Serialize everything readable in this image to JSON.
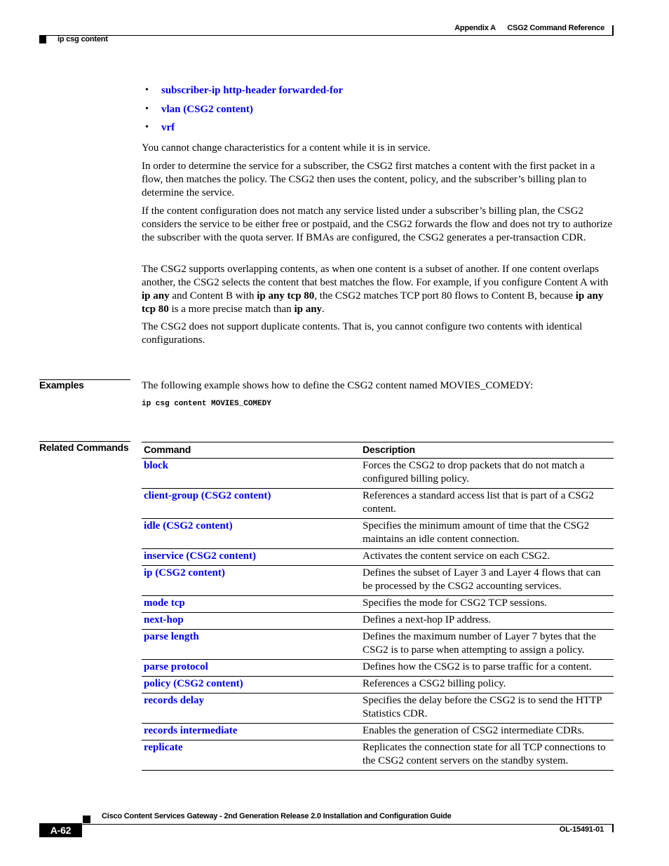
{
  "header": {
    "appendix": "Appendix A",
    "chapter": "CSG2 Command Reference",
    "section": "ip csg content"
  },
  "bullets": [
    "subscriber-ip http-header forwarded-for",
    "vlan (CSG2 content)",
    "vrf"
  ],
  "paragraphs": {
    "p1": "You cannot change characteristics for a content while it is in service.",
    "p2": "In order to determine the service for a subscriber, the CSG2 first matches a content with the first packet in a flow, then matches the policy. The CSG2 then uses the content, policy, and the subscriber’s billing plan to determine the service.",
    "p3": "If the content configuration does not match any service listed under a subscriber’s billing plan, the CSG2 considers the service to be either free or postpaid, and the CSG2 forwards the flow and does not try to authorize the subscriber with the quota server. If BMAs are configured, the CSG2 generates a per-transaction CDR.",
    "p4": {
      "t1": "The CSG2 supports overlapping contents, as when one content is a subset of another. If one content overlaps another, the CSG2 selects the content that best matches the flow. For example, if you configure Content A with ",
      "b1": "ip any",
      "t2": " and Content B with ",
      "b2": "ip any tcp 80",
      "t3": ", the CSG2 matches TCP port 80 flows to Content B, because ",
      "b3": "ip any tcp 80",
      "t4": " is a more precise match than ",
      "b4": "ip any",
      "t5": "."
    },
    "p5": "The CSG2 does not support duplicate contents. That is, you cannot configure two contents with identical configurations."
  },
  "examples": {
    "label": "Examples",
    "text": "The following example shows how to define the CSG2 content named MOVIES_COMEDY:",
    "code": "ip csg content MOVIES_COMEDY"
  },
  "related": {
    "label": "Related Commands",
    "headers": {
      "command": "Command",
      "description": "Description"
    },
    "rows": [
      {
        "command": "block",
        "description": "Forces the CSG2 to drop packets that do not match a configured billing policy."
      },
      {
        "command": "client-group (CSG2 content)",
        "description": "References a standard access list that is part of a CSG2 content."
      },
      {
        "command": "idle (CSG2 content)",
        "description": "Specifies the minimum amount of time that the CSG2 maintains an idle content connection."
      },
      {
        "command": "inservice (CSG2 content)",
        "description": "Activates the content service on each CSG2."
      },
      {
        "command": "ip (CSG2 content)",
        "description": "Defines the subset of Layer 3 and Layer 4 flows that can be processed by the CSG2 accounting services."
      },
      {
        "command": "mode tcp",
        "description": "Specifies the mode for CSG2 TCP sessions."
      },
      {
        "command": "next-hop",
        "description": "Defines a next-hop IP address."
      },
      {
        "command": "parse length",
        "description": "Defines the maximum number of Layer 7 bytes that the CSG2 is to parse when attempting to assign a policy."
      },
      {
        "command": "parse protocol",
        "description": "Defines how the CSG2 is to parse traffic for a content."
      },
      {
        "command": "policy (CSG2 content)",
        "description": "References a CSG2 billing policy."
      },
      {
        "command": "records delay",
        "description": "Specifies the delay before the CSG2 is to send the HTTP Statistics CDR."
      },
      {
        "command": "records intermediate",
        "description": "Enables the generation of CSG2 intermediate CDRs."
      },
      {
        "command": "replicate",
        "description": "Replicates the connection state for all TCP connections to the CSG2 content servers on the standby system."
      }
    ]
  },
  "footer": {
    "title": "Cisco Content Services Gateway - 2nd Generation Release 2.0 Installation and Configuration Guide",
    "page": "A-62",
    "doc_id": "OL-15491-01"
  },
  "colors": {
    "link": "#0000ee",
    "text": "#000000"
  }
}
